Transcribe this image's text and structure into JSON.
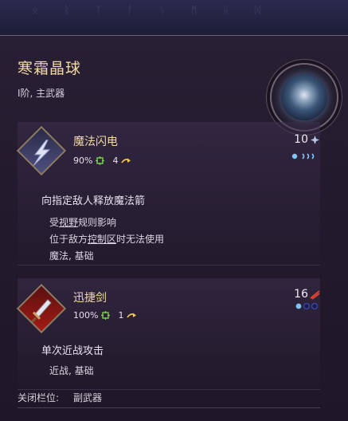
{
  "item": {
    "title": "寒霜晶球",
    "subtitle": "I阶, 主武器"
  },
  "skills": [
    {
      "name": "魔法闪电",
      "accuracy": "90%",
      "range": "4",
      "cost": "10",
      "description": "向指定敌人释放魔法箭",
      "notes": [
        "受视野规则影响",
        "位于敌方控制区时无法使用",
        "魔法, 基础"
      ]
    },
    {
      "name": "迅捷剑",
      "accuracy": "100%",
      "range": "1",
      "cost": "16",
      "description": "单次近战攻击",
      "notes": [
        "近战, 基础"
      ]
    }
  ],
  "footer": {
    "label": "关闭栏位:",
    "value": "副武器"
  },
  "colors": {
    "title": "#f1d9a6",
    "panel": "#231a2d",
    "accuracy_icon": "#7bd34b",
    "range_icon": "#f2c94c"
  },
  "icons": [
    "lightning-bolt-icon",
    "sword-icon",
    "accuracy-icon",
    "range-arrow-icon",
    "blue-crystal-icon",
    "red-slash-icon"
  ]
}
